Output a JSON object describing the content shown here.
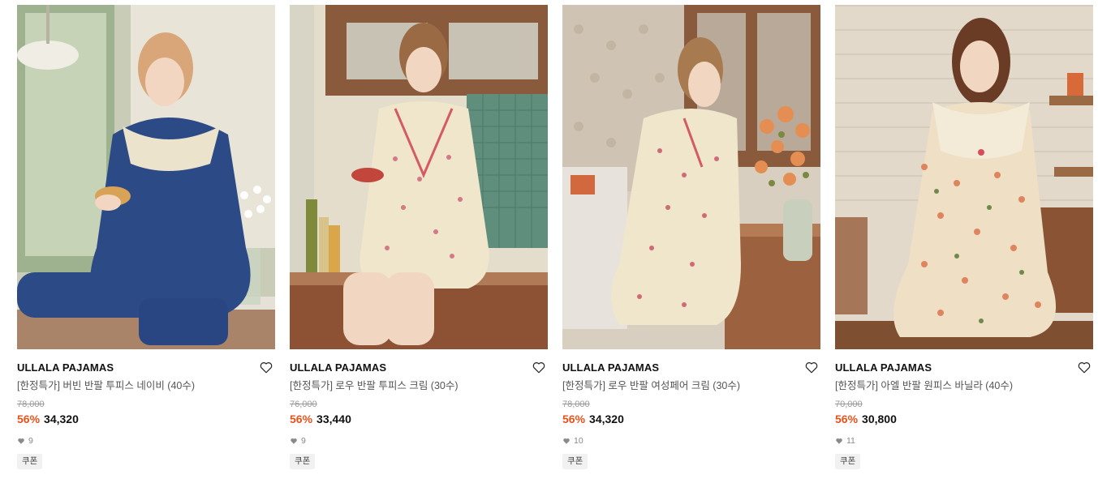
{
  "products": [
    {
      "image_label": "woman in navy short-sleeve pajama set eating a pastry",
      "brand": "ULLALA PAJAMAS",
      "title": "[한정특가] 버빈 반팔 투피스 네이비 (40수)",
      "original_price": "78,000",
      "discount": "56%",
      "price": "34,320",
      "likes": "9",
      "coupon": "쿠폰"
    },
    {
      "image_label": "woman in cream floral short pajama set in kitchen",
      "brand": "ULLALA PAJAMAS",
      "title": "[한정특가] 로우 반팔 투피스 크림 (30수)",
      "original_price": "76,000",
      "discount": "56%",
      "price": "33,440",
      "likes": "9",
      "coupon": "쿠폰"
    },
    {
      "image_label": "woman in cream floral pajamas arranging flowers at table",
      "brand": "ULLALA PAJAMAS",
      "title": "[한정특가] 로우 반팔 여성페어 크림 (30수)",
      "original_price": "78,000",
      "discount": "56%",
      "price": "34,320",
      "likes": "10",
      "coupon": "쿠폰"
    },
    {
      "image_label": "woman in vanilla floral nightgown sitting on counter",
      "brand": "ULLALA PAJAMAS",
      "title": "[한정특가] 아엘 반팔 원피스 바닐라 (40수)",
      "original_price": "70,000",
      "discount": "56%",
      "price": "30,800",
      "likes": "11",
      "coupon": "쿠폰"
    }
  ],
  "colors": {
    "discount": "#e8531d",
    "brand_text": "#111111",
    "title_text": "#555555",
    "muted": "#999999",
    "coupon_bg": "#f1f1f1"
  },
  "icons": {
    "wishlist": "heart-outline-icon",
    "likes": "heart-filled-icon"
  }
}
